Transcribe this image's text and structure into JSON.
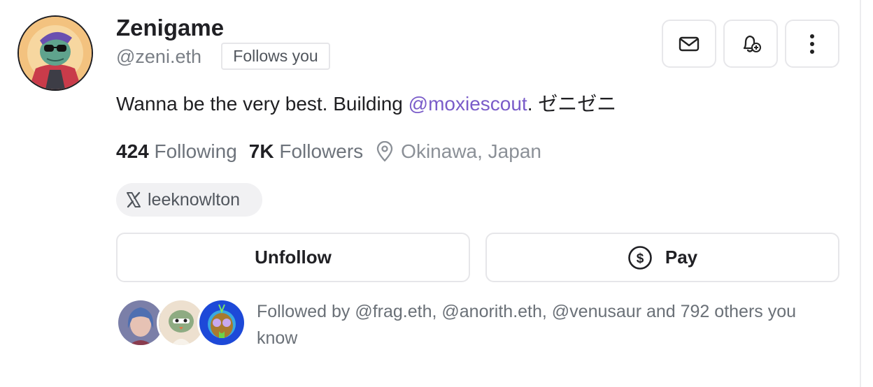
{
  "profile": {
    "display_name": "Zenigame",
    "handle": "@zeni.eth",
    "follows_you_label": "Follows you",
    "bio_prefix": "Wanna be the very best. Building ",
    "bio_mention": "@moxiescout",
    "bio_suffix": ". ゼニゼニ",
    "following_count": "424",
    "following_label": "Following",
    "followers_count": "7K",
    "followers_label": "Followers",
    "location": "Okinawa, Japan",
    "x_handle": "leeknowlton"
  },
  "actions": {
    "message_icon": "envelope-icon",
    "notify_icon": "bell-plus-icon",
    "more_icon": "more-vertical-icon",
    "unfollow_label": "Unfollow",
    "pay_label": "Pay",
    "pay_icon": "dollar-circle-icon"
  },
  "mutuals": {
    "text": "Followed by @frag.eth, @anorith.eth, @venusaur and 792 others you know"
  },
  "colors": {
    "mention": "#7a5cc9",
    "muted_text": "#7a7f86",
    "border": "#e6e6e9",
    "chip_bg": "#f1f1f3"
  }
}
